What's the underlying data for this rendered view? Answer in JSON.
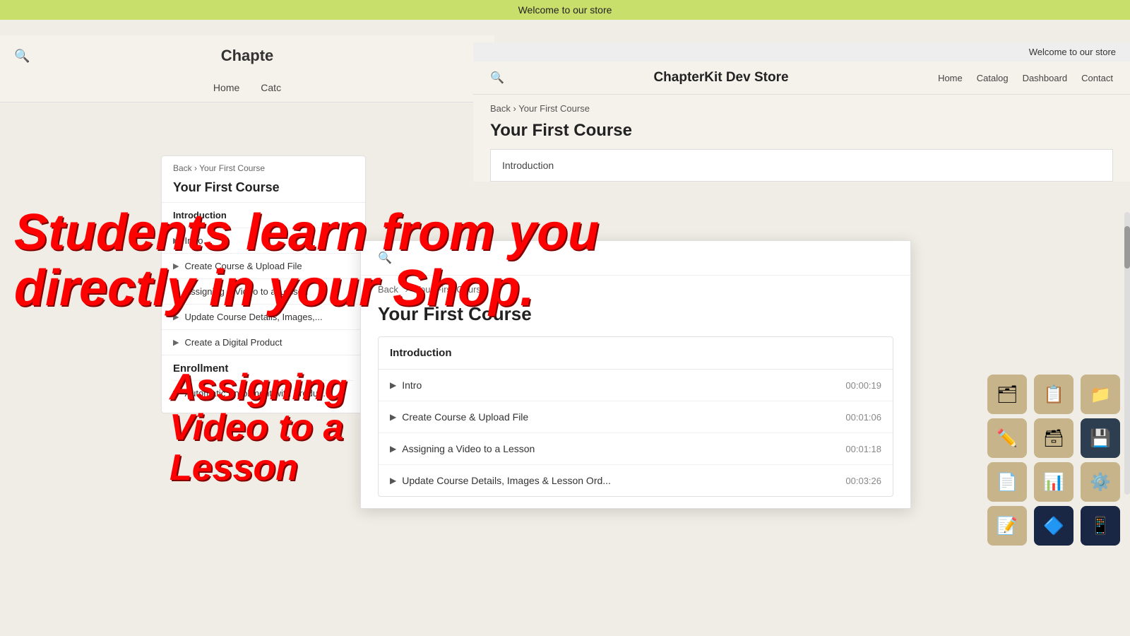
{
  "welcome_bar": {
    "text": "Welcome to our store"
  },
  "window1": {
    "logo": "Chapte",
    "nav": [
      "Home",
      "Catc"
    ],
    "breadcrumb": {
      "back": "Back",
      "course": "Your First Course"
    },
    "course_title": "Your First Course"
  },
  "window2_top": {
    "welcome": "Welcome to our store",
    "logo": "ChapterKit Dev Store",
    "nav": [
      "Home",
      "Catalog",
      "Dashboard",
      "Contact"
    ]
  },
  "window2_dark": {
    "welcome": "Welcome to our store",
    "logo": "ChapterKit Dev Store",
    "nav": [
      "Home",
      "Catalog",
      "Dashboard",
      "Contact"
    ]
  },
  "window3": {
    "breadcrumb_back": "Back",
    "breadcrumb_course": "Your First Course",
    "course_title": "Your First Course",
    "sections": [
      {
        "title": "Introduction",
        "lessons": [
          {
            "name": "Intro",
            "duration": "00:00:19"
          },
          {
            "name": "Create Course & Upload File",
            "duration": "00:01:06"
          },
          {
            "name": "Assigning a Video to a Lesson",
            "duration": "00:01:18"
          },
          {
            "name": "Update Course Details, Images & Lesson Ord...",
            "duration": "00:03:26"
          }
        ]
      }
    ]
  },
  "sidebar": {
    "breadcrumb_back": "Back",
    "breadcrumb_course": "Your First Course",
    "course_title": "Your First Course",
    "section": "Introduction",
    "lessons": [
      {
        "name": "Intro"
      },
      {
        "name": "Create Course & Upload File"
      },
      {
        "name": "Assigning a Video to a Lesson"
      },
      {
        "name": "Update Course Details, Images,..."
      },
      {
        "name": "Create a Digital Product"
      }
    ],
    "enrollment_title": "Enrollment",
    "enrollment_lessons": [
      {
        "name": "Automatic Enrollment with Produ..."
      }
    ]
  },
  "right_panel": {
    "breadcrumb_back": "Back",
    "breadcrumb_course": "Your First Course",
    "course_title": "Your First Course",
    "section": "Introduction"
  },
  "overlay": {
    "line1": "Students learn from you",
    "line2": "directly in your Shop."
  },
  "big_lesson_text": "Assigning Video to a Lesson",
  "icons": [
    {
      "type": "light-tan",
      "glyph": "🗂"
    },
    {
      "type": "light-tan",
      "glyph": "📋"
    },
    {
      "type": "light-tan",
      "glyph": "📁"
    },
    {
      "type": "light-tan",
      "glyph": "✏️"
    },
    {
      "type": "light-tan",
      "glyph": "🗃"
    },
    {
      "type": "dark",
      "glyph": "💾"
    },
    {
      "type": "light-tan",
      "glyph": "📄"
    },
    {
      "type": "light-tan",
      "glyph": "📊"
    },
    {
      "type": "light-tan",
      "glyph": "⚙️"
    },
    {
      "type": "light-tan",
      "glyph": "📝"
    },
    {
      "type": "blue-dark",
      "glyph": "🔷"
    },
    {
      "type": "blue-dark",
      "glyph": "📱"
    }
  ]
}
